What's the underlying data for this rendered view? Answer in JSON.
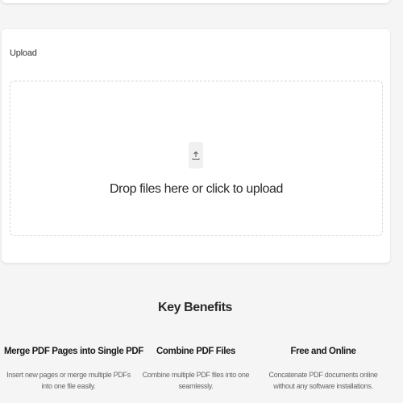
{
  "upload": {
    "label": "Upload",
    "dropzone_text": "Drop files here or click to upload",
    "icon": "upload-icon"
  },
  "benefits": {
    "heading": "Key Benefits",
    "items": [
      {
        "title": "Merge PDF Pages into Single PDF",
        "description": "Insert new pages or merge multiple PDFs into one file easily."
      },
      {
        "title": "Combine PDF Files",
        "description": "Combine multiple PDF files into one seamlessly."
      },
      {
        "title": "Free and Online",
        "description": "Concatenate PDF documents online without any software installations."
      }
    ]
  }
}
